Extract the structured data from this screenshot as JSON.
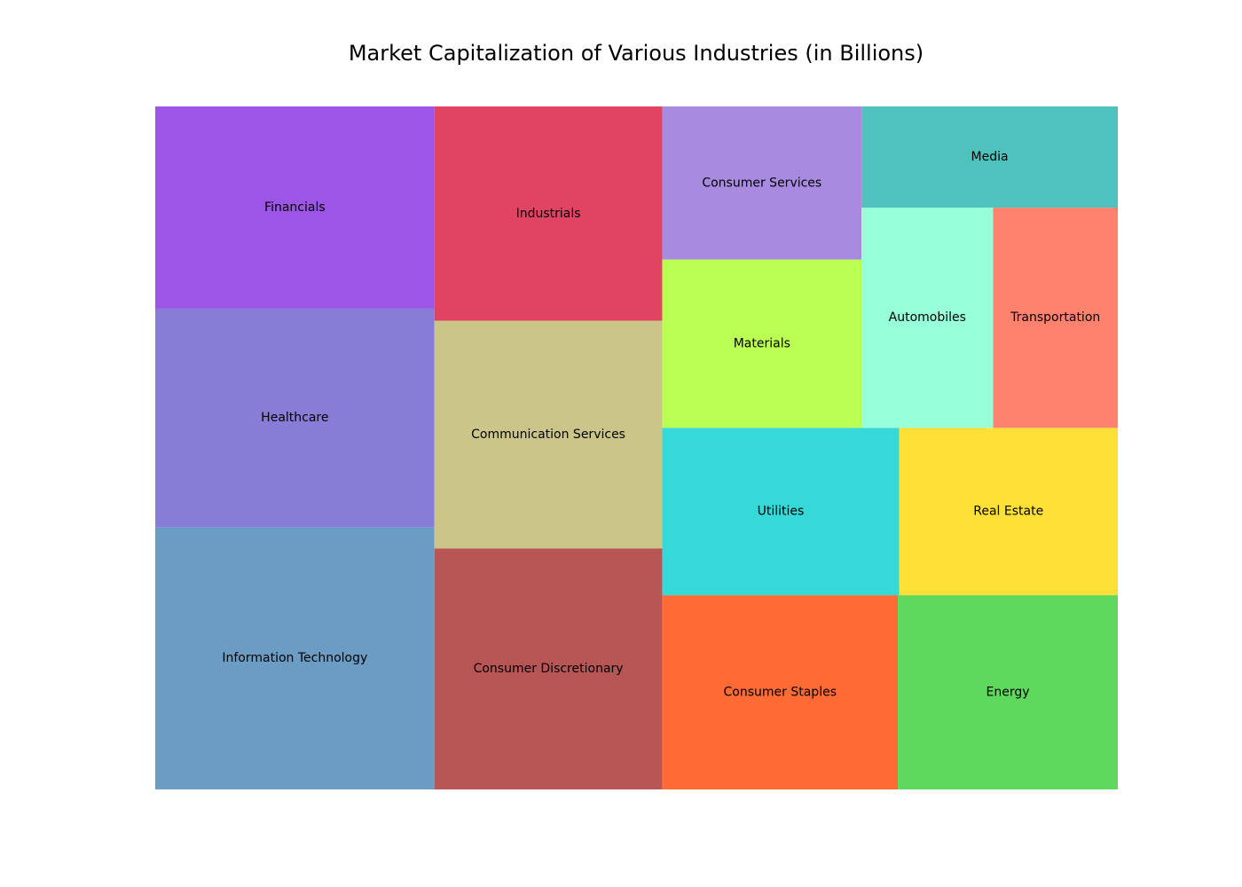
{
  "chart_data": {
    "type": "treemap",
    "title": "Market Capitalization of Various Industries (in Billions)",
    "unit": "Billions",
    "items": [
      {
        "label": "Information Technology",
        "value": 2400,
        "color": "#6a9cc4"
      },
      {
        "label": "Healthcare",
        "value": 2000,
        "color": "#887dd6"
      },
      {
        "label": "Financials",
        "value": 1850,
        "color": "#9c55e6"
      },
      {
        "label": "Consumer Discretionary",
        "value": 1800,
        "color": "#b85555"
      },
      {
        "label": "Communication Services",
        "value": 1700,
        "color": "#cbc58a"
      },
      {
        "label": "Industrials",
        "value": 1600,
        "color": "#e14463"
      },
      {
        "label": "Consumer Staples",
        "value": 1500,
        "color": "#ff6a35"
      },
      {
        "label": "Energy",
        "value": 1400,
        "color": "#5ed95e"
      },
      {
        "label": "Utilities",
        "value": 1300,
        "color": "#36d8d8"
      },
      {
        "label": "Real Estate",
        "value": 1200,
        "color": "#ffe036"
      },
      {
        "label": "Materials",
        "value": 1100,
        "color": "#bbff55"
      },
      {
        "label": "Consumer Services",
        "value": 1000,
        "color": "#a88be0"
      },
      {
        "label": "Automobiles",
        "value": 950,
        "color": "#98ffdb"
      },
      {
        "label": "Transportation",
        "value": 900,
        "color": "#ff826e"
      },
      {
        "label": "Media",
        "value": 850,
        "color": "#4fc2bd"
      }
    ]
  }
}
